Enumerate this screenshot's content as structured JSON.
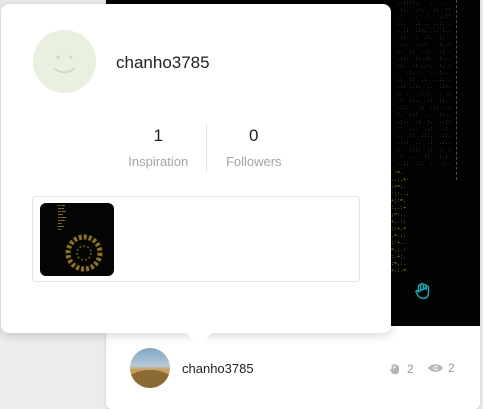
{
  "profile_card": {
    "username": "chanho3785",
    "stats": [
      {
        "value": "1",
        "label": "Inspiration"
      },
      {
        "value": "0",
        "label": "Followers"
      }
    ],
    "avatar_icon": "smiley-face-icon",
    "works": [
      {
        "thumb_icon": "dark-code-artwork-thumbnail"
      }
    ]
  },
  "feed_card": {
    "author": "chanho3785",
    "likes": "2",
    "views": "2",
    "like_icon": "clap-hand-icon",
    "views_icon": "eye-icon"
  },
  "colors": {
    "accent_teal": "#1aa7b0",
    "avatar_bg": "#e9f0e0",
    "muted_text": "#a4a4a4"
  }
}
